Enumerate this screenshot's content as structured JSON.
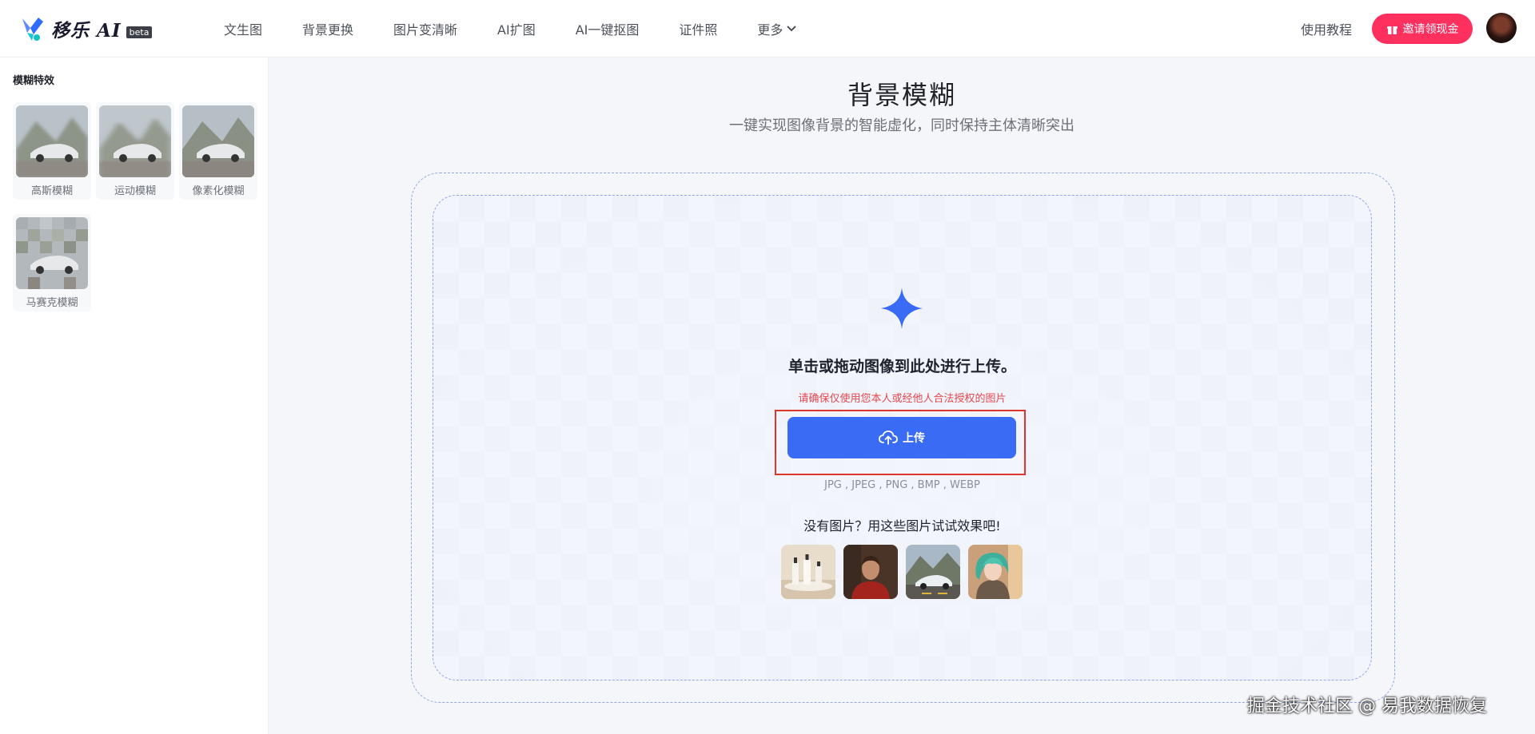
{
  "header": {
    "logo_text": "移乐 AI",
    "logo_badge": "beta",
    "nav": [
      {
        "label": "文生图"
      },
      {
        "label": "背景更换"
      },
      {
        "label": "图片变清晰"
      },
      {
        "label": "AI扩图"
      },
      {
        "label": "AI一键抠图"
      },
      {
        "label": "证件照"
      },
      {
        "label": "更多"
      }
    ],
    "tutorial_label": "使用教程",
    "invite_label": "邀请领现金"
  },
  "sidebar": {
    "title": "模糊特效",
    "effects": [
      {
        "label": "高斯模糊"
      },
      {
        "label": "运动模糊"
      },
      {
        "label": "像素化模糊"
      },
      {
        "label": "马赛克模糊"
      }
    ]
  },
  "main": {
    "title": "背景模糊",
    "subtitle": "一键实现图像背景的智能虚化，同时保持主体清晰突出",
    "drop_hint": "单击或拖动图像到此处进行上传。",
    "legal_note": "请确保仅使用您本人或经他人合法授权的图片",
    "upload_label": "上传",
    "formats": "JPG , JPEG , PNG , BMP , WEBP",
    "try_text": "没有图片？用这些图片试试效果吧!"
  },
  "watermark": "掘金技术社区 @ 易我数据恢复",
  "colors": {
    "accent": "#3a6bf5",
    "invite": "#ff2f5e",
    "warning": "#e5484d",
    "highlight": "#e0332c"
  }
}
